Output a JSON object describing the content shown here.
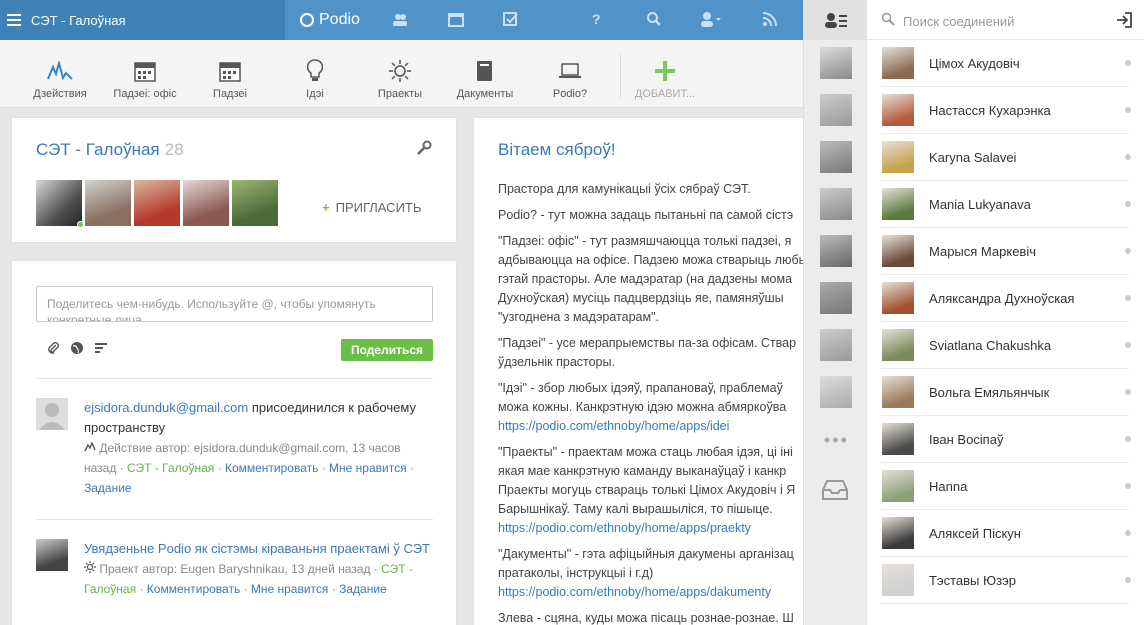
{
  "topbar": {
    "workspace_name": "СЭТ - Галоўная",
    "brand": "Podio"
  },
  "apps": [
    {
      "label": "Дзействия",
      "icon": "activity-icon"
    },
    {
      "label": "Падзеі: офіс",
      "icon": "calendar-icon"
    },
    {
      "label": "Падзеі",
      "icon": "calendar-icon"
    },
    {
      "label": "Ідэі",
      "icon": "lightbulb-icon"
    },
    {
      "label": "Праекты",
      "icon": "sun-icon"
    },
    {
      "label": "Дакументы",
      "icon": "book-icon"
    },
    {
      "label": "Podio?",
      "icon": "laptop-icon"
    },
    {
      "label": "ДОБАВИТ...",
      "icon": "plus-icon"
    }
  ],
  "workspace": {
    "title": "СЭТ - Галоўная",
    "member_count": "28",
    "invite_label": "ПРИГЛАСИТЬ"
  },
  "share": {
    "placeholder": "Поделитесь чем-нибудь. Используйте @, чтобы упомянуть конкретные лица",
    "button": "Поделиться"
  },
  "stream": [
    {
      "actor": "ejsidora.dunduk@gmail.com",
      "text": " присоединился к рабочему пространству",
      "meta_prefix": "Действие автор: ejsidora.dunduk@gmail.com, 13 часов назад · ",
      "workspace_link": "СЭТ - Галоўная",
      "comment": "Комментировать",
      "like": "Мне нравится",
      "task": "Задание"
    },
    {
      "title": "Увядзеньне Podio як сістэмы кіраваньня праектамі ў СЭТ",
      "meta_prefix": "Праект автор: Eugen Baryshnikau, 13 дней назад · ",
      "workspace_link": "СЭТ - Галоўная",
      "comment": "Комментировать",
      "like": "Мне нравится",
      "task": "Задание"
    }
  ],
  "welcome": {
    "title": "Вітаем сяброў!",
    "p1": "Прастора для камунікацыі ўсіх сябраў СЭТ.",
    "p2": "Podio? - тут можна задаць пытаньні па самой сістэ",
    "p3a": "\"Падзеі: офіс\" - тут размяшчаюцца толькі падзеі, я",
    "p3b": "адбываюцца на офісе. Падзею можа стварыць любы",
    "p3c": "гэтай прасторы. Але мадэратар (на дадзены мома",
    "p3d": "Духноўская) мусіць падцвердзіць яе, памяняўшы",
    "p3e": "\"узгоднена з мадэратарам\".",
    "p4a": "\"Падзеі\" - усе мерапрыемствы па-за офісам. Ствар",
    "p4b": "ўдзельнік прасторы.",
    "p5a": "\"Ідэі\" - збор любых ідэяў, прапановаў, праблемаў",
    "p5b": "можа кожны. Канкрэтную ідэю можна абмяркоўва",
    "p5c": "https://podio.com/ethnoby/home/apps/idei",
    "p6a": "\"Праекты\" - праектам можа стаць любая ідэя, ці іні",
    "p6b": "якая мае канкрэтную каманду выканаўцаў і канкр",
    "p6c": "Праекты могуць ствараць толькі Цімох Акудовіч і Я",
    "p6d": "Барышнікаў. Таму калі вырашыліся, то пішыце.",
    "p6e": "https://podio.com/ethnoby/home/apps/praekty",
    "p7a": "\"Дакументы\" - гэта афіцыйныя дакумены арганізац",
    "p7b": "пратаколы, інструкцыі і г.д)",
    "p7c": "https://podio.com/ethnoby/home/apps/dakumenty",
    "p8": "Злева - сцяна, куды можа пісаць рознае-рознае. Ш"
  },
  "contacts": {
    "search_placeholder": "Поиск соединений",
    "items": [
      {
        "name": "Цімох Акудовіч",
        "color": "#8a6a52"
      },
      {
        "name": "Настасся Кухарэнка",
        "color": "#b55a3c"
      },
      {
        "name": "Karyna Salavei",
        "color": "#c7a24a"
      },
      {
        "name": "Mania Lukyanava",
        "color": "#5a7a3e"
      },
      {
        "name": "Марыся Маркевіч",
        "color": "#6a4a3a"
      },
      {
        "name": "Аляксандра Духноўская",
        "color": "#a0522d"
      },
      {
        "name": "Sviatlana Chakushka",
        "color": "#7a8a5a"
      },
      {
        "name": "Вольга Емяльянчык",
        "color": "#9a7a5a"
      },
      {
        "name": "Іван Восіпаў",
        "color": "#4a4a4a"
      },
      {
        "name": "Hanna",
        "color": "#8aa07a"
      },
      {
        "name": "Аляксей Піскун",
        "color": "#3a3a3a"
      },
      {
        "name": "Тэставы Юзэр",
        "color": "#d0d0d0"
      }
    ]
  }
}
